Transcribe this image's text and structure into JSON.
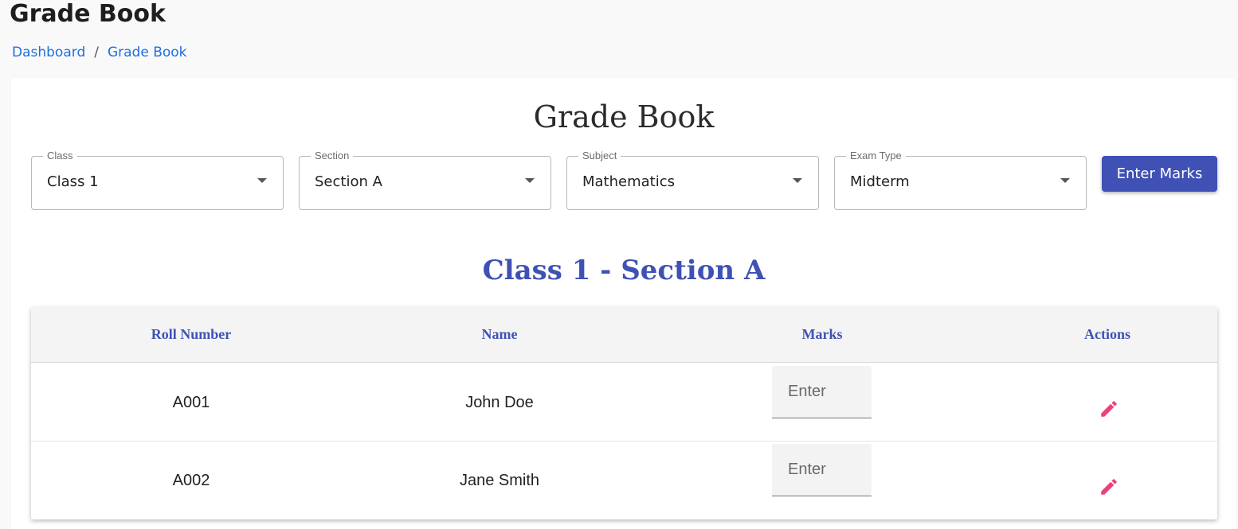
{
  "header": {
    "title": "Grade Book",
    "breadcrumb": {
      "items": [
        "Dashboard",
        "Grade Book"
      ],
      "separator": "/"
    }
  },
  "card": {
    "title": "Grade Book",
    "filters": [
      {
        "label": "Class",
        "value": "Class 1"
      },
      {
        "label": "Section",
        "value": "Section A"
      },
      {
        "label": "Subject",
        "value": "Mathematics"
      },
      {
        "label": "Exam Type",
        "value": "Midterm"
      }
    ],
    "enter_marks_label": "Enter Marks",
    "section_heading": "Class 1 - Section A"
  },
  "table": {
    "columns": [
      "Roll Number",
      "Name",
      "Marks",
      "Actions"
    ],
    "rows": [
      {
        "roll": "A001",
        "name": "John Doe",
        "marks": "",
        "marks_placeholder": "Enter",
        "action_icon": "pencil-icon"
      },
      {
        "roll": "A002",
        "name": "Jane Smith",
        "marks": "",
        "marks_placeholder": "Enter",
        "action_icon": "pencil-icon"
      }
    ]
  },
  "colors": {
    "primary": "#3f51b5",
    "link": "#1f6fe0",
    "edit_icon": "#ec407a"
  }
}
